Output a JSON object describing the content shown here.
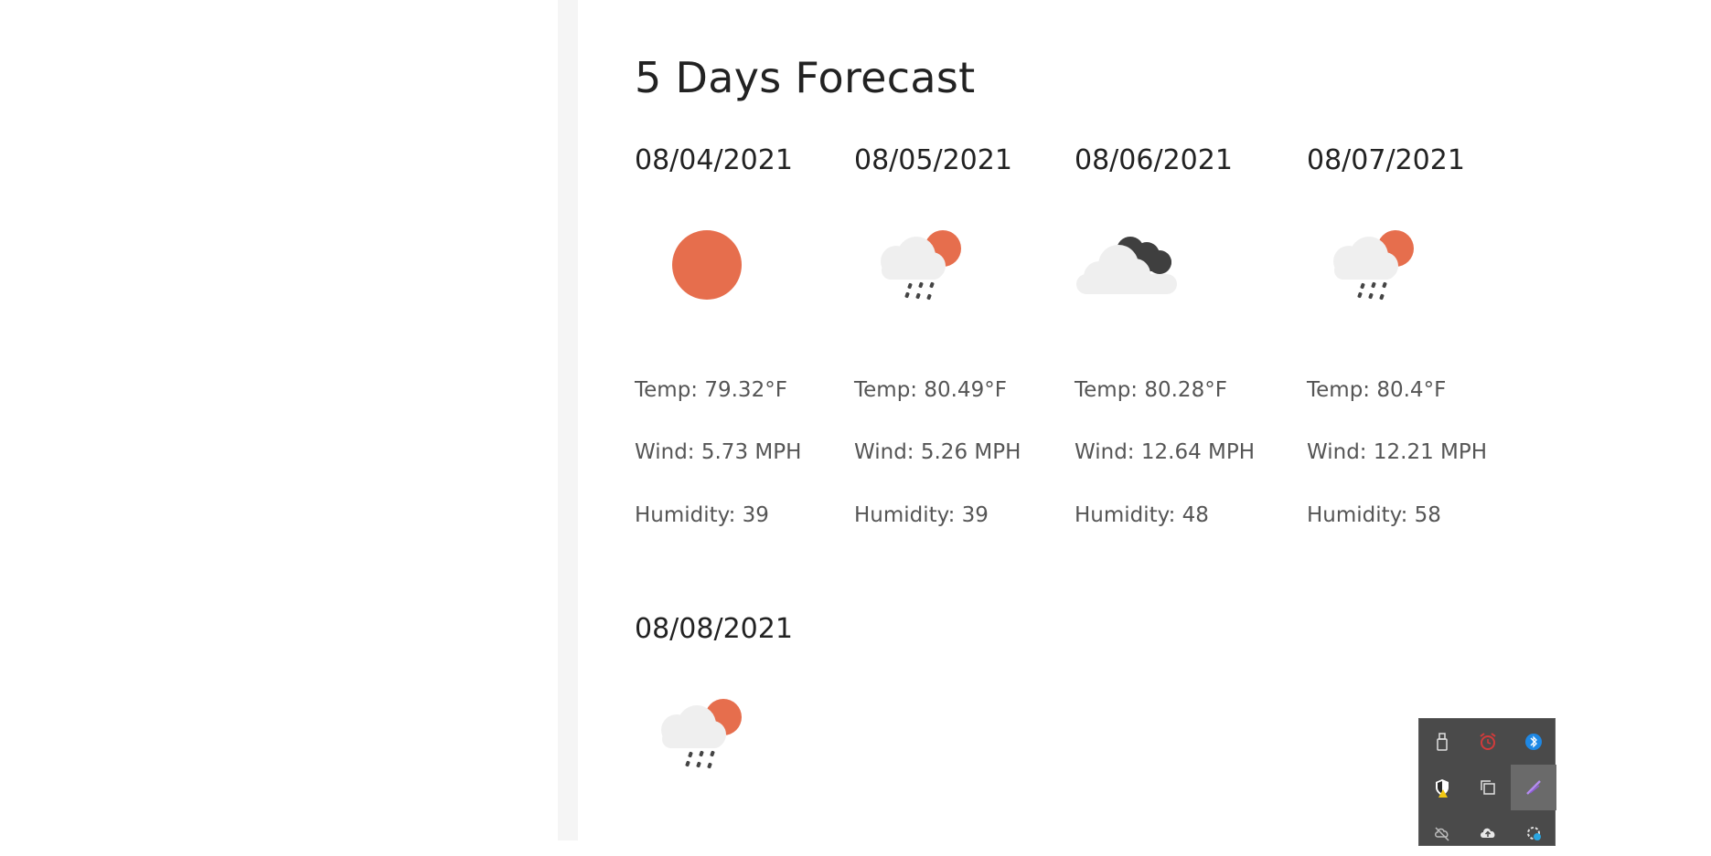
{
  "forecast": {
    "title": "5 Days Forecast",
    "days": [
      {
        "date": "08/04/2021",
        "icon": "sun-icon",
        "temp": "Temp: 79.32°F",
        "wind": "Wind: 5.73 MPH",
        "humidity": "Humidity: 39"
      },
      {
        "date": "08/05/2021",
        "icon": "sun-rain-cloud-icon",
        "temp": "Temp: 80.49°F",
        "wind": "Wind: 5.26 MPH",
        "humidity": "Humidity: 39"
      },
      {
        "date": "08/06/2021",
        "icon": "dark-cloud-icon",
        "temp": "Temp: 80.28°F",
        "wind": "Wind: 12.64 MPH",
        "humidity": "Humidity: 48"
      },
      {
        "date": "08/07/2021",
        "icon": "sun-rain-cloud-icon",
        "temp": "Temp: 80.4°F",
        "wind": "Wind: 12.21 MPH",
        "humidity": "Humidity: 58"
      },
      {
        "date": "08/08/2021",
        "icon": "sun-rain-cloud-icon",
        "temp": "",
        "wind": "",
        "humidity": ""
      }
    ]
  },
  "colors": {
    "sun": "#e66e4d",
    "cloud_light": "#efefef",
    "cloud_dark": "#3f3f3f",
    "rain": "#444444",
    "tray_bg": "#4a4a4a"
  },
  "tray": {
    "icons": [
      "usb-drive-icon",
      "alarm-icon",
      "bluetooth-icon",
      "security-shield-icon",
      "copy-window-icon",
      "pen-icon",
      "cloud-offline-icon",
      "cloud-upload-icon",
      "settings-sync-icon"
    ]
  }
}
